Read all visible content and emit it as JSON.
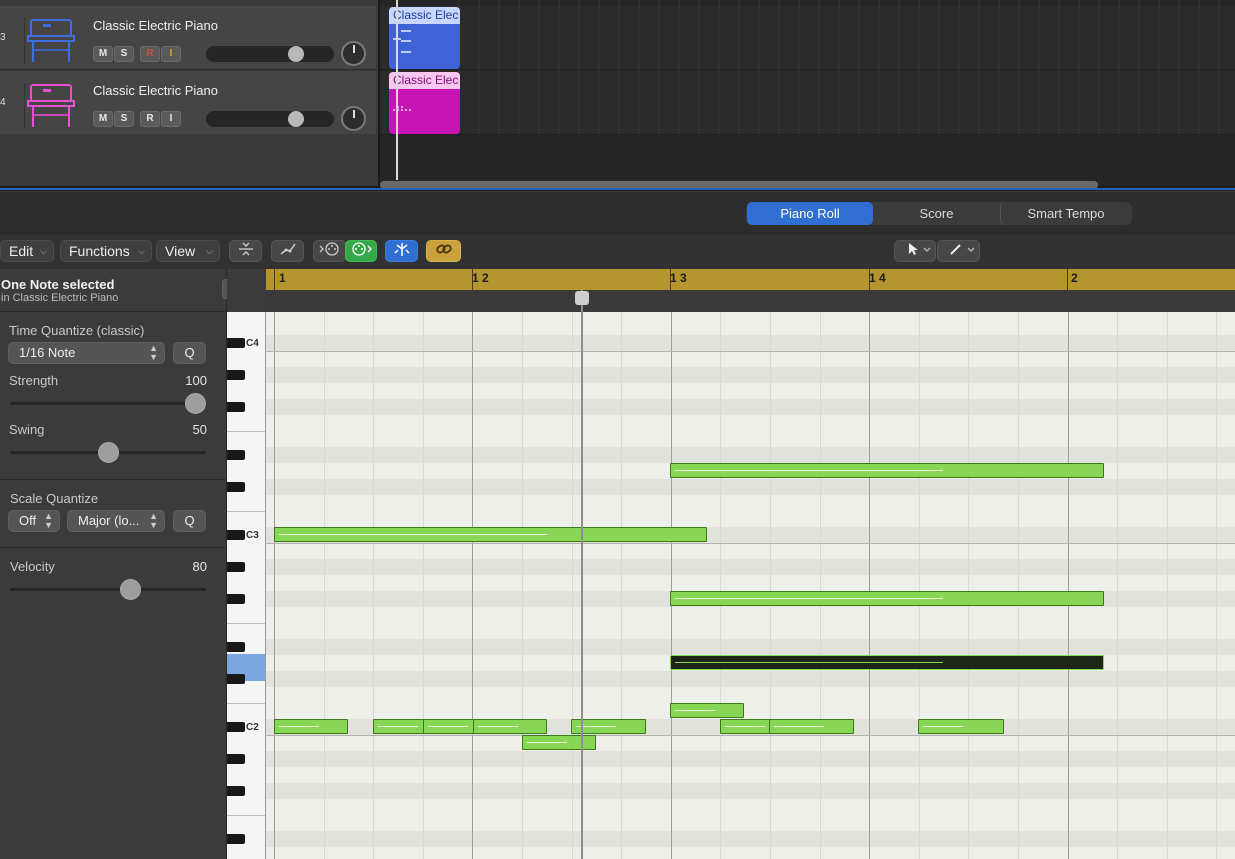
{
  "tracks": [
    {
      "number": "3",
      "name": "Classic Electric Piano",
      "buttons": {
        "mute": "M",
        "solo": "S",
        "record": "R",
        "input": "I"
      },
      "icon": "piano-keyboard-icon",
      "icon_color": "#3d6de0",
      "record_color": "#d94a3b",
      "input_color": "#e0a52a",
      "volume": 0.7,
      "region": {
        "name": "Classic Elec",
        "color": "#3e63d6",
        "header_color": "#c9d6ff"
      }
    },
    {
      "number": "4",
      "name": "Classic Electric Piano",
      "buttons": {
        "mute": "M",
        "solo": "S",
        "record": "R",
        "input": "I"
      },
      "icon": "piano-keyboard-icon",
      "icon_color": "#e84fd3",
      "volume": 0.7,
      "region": {
        "name": "Classic Elec",
        "color": "#c714b2",
        "header_color": "#f7c8ef"
      }
    }
  ],
  "editor_tabs": [
    {
      "label": "Piano Roll",
      "active": true
    },
    {
      "label": "Score",
      "active": false
    },
    {
      "label": "Smart Tempo",
      "active": false
    }
  ],
  "toolbar": {
    "edit": "Edit",
    "functions": "Functions",
    "view": "View",
    "tools": [
      "collapse-icon",
      "automation-icon",
      "midi-in-icon",
      "midi-out-icon",
      "catch-icon",
      "link-icon"
    ],
    "pointer_tool": "pointer-tool-icon",
    "pencil_tool": "pencil-tool-icon"
  },
  "inspector": {
    "selection_title": "One Note selected",
    "selection_sub": "in Classic Electric Piano",
    "time_quantize": {
      "label": "Time Quantize (classic)",
      "value": "1/16 Note",
      "q": "Q"
    },
    "strength": {
      "label": "Strength",
      "value": "100",
      "level": 1.0
    },
    "swing": {
      "label": "Swing",
      "value": "50",
      "level": 0.5
    },
    "scale_quantize": {
      "label": "Scale Quantize",
      "off": "Off",
      "scale": "Major (lo...",
      "q": "Q"
    },
    "velocity": {
      "label": "Velocity",
      "value": "80",
      "level": 0.63
    }
  },
  "ruler": {
    "bars": [
      "1",
      "1 2",
      "1 3",
      "1 4",
      "2"
    ]
  },
  "keyboard": {
    "labels": [
      "C4",
      "C3",
      "C2"
    ]
  },
  "colors": {
    "accent": "#2f6fd1",
    "note": "#88d655",
    "ruler": "#b5952e",
    "selected_key": "#7aa7e0"
  }
}
